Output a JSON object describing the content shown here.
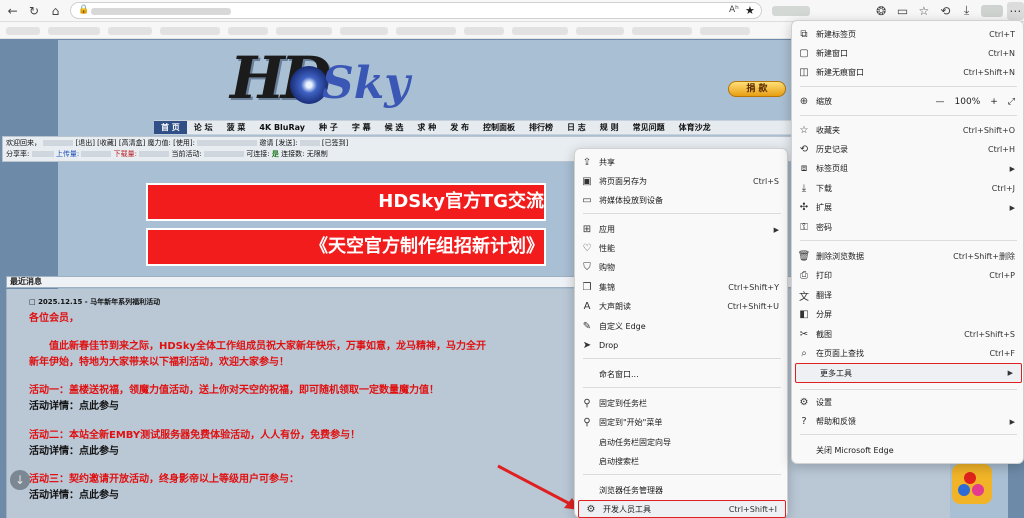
{
  "browser": {
    "address_placeholder": "",
    "reader_label": "Aʰ"
  },
  "site": {
    "logo_hd": "HD",
    "logo_sky": "Sky",
    "donate": "捐 款",
    "nav": [
      "首 页",
      "论 坛",
      "菠 菜",
      "4K BluRay",
      "种 子",
      "字 幕",
      "候 选",
      "求 种",
      "发 布",
      "控制面板",
      "排行榜",
      "日 志",
      "规 则",
      "常见问题",
      "体育沙龙"
    ],
    "info_line1_welcome": "欢迎回来，",
    "info_line1_rest": "[退出] [收藏] [高清盒] 魔力值: [使用]:",
    "info_line1_invite": "邀请 [发送]:",
    "info_line1_signed": "[已签到]",
    "info_line2_ratio": "分享率:",
    "info_line2_up": "上传量:",
    "info_line2_down": "下载量:",
    "info_line2_active": "当前活动:",
    "info_line2_connectable": "可连接:",
    "info_line2_yes": "是",
    "info_line2_limit": "连接数: 无限制",
    "banner1": "HDSky官方TG交流",
    "banner2": "《天空官方制作组招新计划》"
  },
  "news": {
    "title": "最近消息",
    "date": "2025.12.15 - 马年新年系列福利活动",
    "lines": [
      "各位会员，",
      "值此新春佳节到来之际，HDSky全体工作组成员祝大家新年快乐，万事如意，龙马精神，马力全开",
      "新年伊始，特地为大家带来以下福利活动，欢迎大家参与！",
      "活动一：盖楼送祝福，领魔力值活动，送上你对天空的祝福，即可随机领取一定数量魔力值！",
      "活动详情：点此参与",
      "活动二：本站全新EMBY测试服务器免费体验活动，人人有份，免费参与！",
      "活动详情：点此参与",
      "活动三：契约邀请开放活动，终身影帝以上等级用户可参与：",
      "活动详情：点此参与"
    ]
  },
  "context_menu": {
    "items": [
      {
        "label": "共享",
        "shortcut": "",
        "icon": "share-icon"
      },
      {
        "label": "将页面另存为",
        "shortcut": "Ctrl+S",
        "icon": "save-icon"
      },
      {
        "label": "将媒体投放到设备",
        "shortcut": "",
        "icon": "cast-icon"
      },
      {
        "label": "应用",
        "shortcut": "",
        "icon": "apps-icon"
      },
      {
        "label": "性能",
        "shortcut": "",
        "icon": "heart-icon"
      },
      {
        "label": "购物",
        "shortcut": "",
        "icon": "shopping-icon"
      },
      {
        "label": "集锦",
        "shortcut": "Ctrl+Shift+Y",
        "icon": "collections-icon"
      },
      {
        "label": "大声朗读",
        "shortcut": "Ctrl+Shift+U",
        "icon": "read-aloud-icon"
      },
      {
        "label": "自定义 Edge",
        "shortcut": "",
        "icon": "customize-icon"
      },
      {
        "label": "Drop",
        "shortcut": "",
        "icon": "drop-icon"
      },
      {
        "label": "命名窗口...",
        "shortcut": "",
        "icon": ""
      },
      {
        "label": "固定到任务栏",
        "shortcut": "",
        "icon": "pin-icon"
      },
      {
        "label": "固定到\"开始\"菜单",
        "shortcut": "",
        "icon": "pin-icon"
      },
      {
        "label": "启动任务栏固定向导",
        "shortcut": "",
        "icon": ""
      },
      {
        "label": "启动搜索栏",
        "shortcut": "",
        "icon": ""
      },
      {
        "label": "浏览器任务管理器",
        "shortcut": "",
        "icon": ""
      },
      {
        "label": "开发人员工具",
        "shortcut": "Ctrl+Shift+I",
        "icon": "devtools-icon"
      }
    ]
  },
  "main_menu": {
    "items": [
      {
        "label": "新建标签页",
        "shortcut": "Ctrl+T",
        "icon": "new-tab-icon"
      },
      {
        "label": "新建窗口",
        "shortcut": "Ctrl+N",
        "icon": "new-window-icon"
      },
      {
        "label": "新建无痕窗口",
        "shortcut": "Ctrl+Shift+N",
        "icon": "inprivate-icon"
      },
      {
        "label": "缩放",
        "shortcut": "",
        "icon": "zoom-icon"
      },
      {
        "label": "收藏夹",
        "shortcut": "Ctrl+Shift+O",
        "icon": "favorites-icon"
      },
      {
        "label": "历史记录",
        "shortcut": "Ctrl+H",
        "icon": "history-icon"
      },
      {
        "label": "标签页组",
        "shortcut": "",
        "icon": "tab-groups-icon"
      },
      {
        "label": "下载",
        "shortcut": "Ctrl+J",
        "icon": "download-icon"
      },
      {
        "label": "扩展",
        "shortcut": "",
        "icon": "extensions-icon"
      },
      {
        "label": "密码",
        "shortcut": "",
        "icon": "key-icon"
      },
      {
        "label": "删除浏览数据",
        "shortcut": "Ctrl+Shift+删除",
        "icon": "delete-icon"
      },
      {
        "label": "打印",
        "shortcut": "Ctrl+P",
        "icon": "print-icon"
      },
      {
        "label": "翻译",
        "shortcut": "",
        "icon": "translate-icon"
      },
      {
        "label": "分屏",
        "shortcut": "",
        "icon": "split-screen-icon"
      },
      {
        "label": "截图",
        "shortcut": "Ctrl+Shift+S",
        "icon": "screenshot-icon"
      },
      {
        "label": "在页面上查找",
        "shortcut": "Ctrl+F",
        "icon": "find-icon"
      },
      {
        "label": "更多工具",
        "shortcut": "",
        "icon": ""
      },
      {
        "label": "设置",
        "shortcut": "",
        "icon": "gear-icon"
      },
      {
        "label": "帮助和反馈",
        "shortcut": "",
        "icon": "help-icon"
      },
      {
        "label": "关闭 Microsoft Edge",
        "shortcut": "",
        "icon": ""
      }
    ],
    "zoom_value": "100%",
    "zoom_minus": "—",
    "zoom_plus": "+",
    "zoom_full": "⤢"
  },
  "colors": {
    "highlight_border": "#e02020",
    "banner_red": "#f21c1c",
    "news_red": "#e01010"
  }
}
